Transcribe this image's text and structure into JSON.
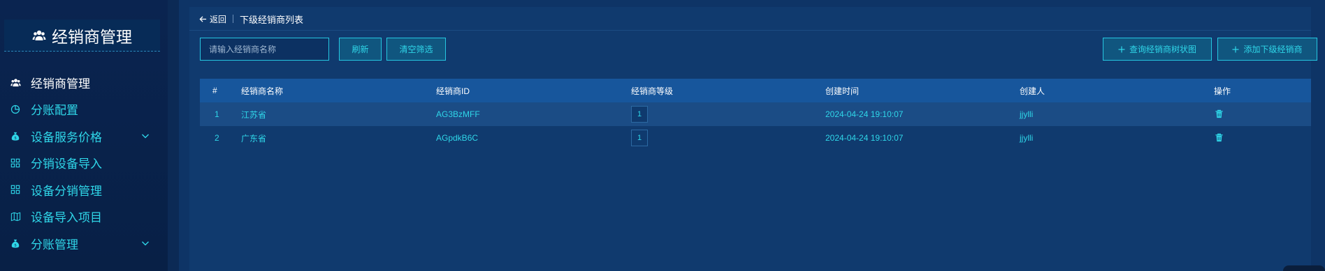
{
  "sidebar": {
    "title": "经销商管理",
    "title_icon": "users-icon",
    "items": [
      {
        "label": "经销商管理",
        "icon": "users-icon",
        "active": true,
        "has_children": false
      },
      {
        "label": "分账配置",
        "icon": "pie-chart-icon",
        "active": false,
        "has_children": false
      },
      {
        "label": "设备服务价格",
        "icon": "money-bag-icon",
        "active": false,
        "has_children": true
      },
      {
        "label": "分销设备导入",
        "icon": "grid-icon",
        "active": false,
        "has_children": false
      },
      {
        "label": "设备分销管理",
        "icon": "grid-icon",
        "active": false,
        "has_children": false
      },
      {
        "label": "设备导入项目",
        "icon": "map-icon",
        "active": false,
        "has_children": false
      },
      {
        "label": "分账管理",
        "icon": "money-bag-icon",
        "active": false,
        "has_children": true
      }
    ]
  },
  "breadcrumb": {
    "back_label": "返回",
    "page_title": "下级经销商列表"
  },
  "toolbar": {
    "search_placeholder": "请输入经销商名称",
    "refresh_label": "刷新",
    "clear_label": "清空筛选",
    "tree_label": "查询经销商树状图",
    "add_label": "添加下级经销商"
  },
  "table": {
    "headers": [
      "#",
      "经销商名称",
      "经销商ID",
      "经销商等级",
      "创建时间",
      "创建人",
      "操作"
    ],
    "rows": [
      {
        "index": "1",
        "name": "江苏省",
        "id": "AG3BzMFF",
        "level": "1",
        "created": "2024-04-24 19:10:07",
        "creator": "jjylli"
      },
      {
        "index": "2",
        "name": "广东省",
        "id": "AGpdkB6C",
        "level": "1",
        "created": "2024-04-24 19:10:07",
        "creator": "jjylli"
      }
    ]
  },
  "colors": {
    "accent": "#2fd6e8",
    "header_bg": "#17569c",
    "page_bg": "#0e3466"
  }
}
